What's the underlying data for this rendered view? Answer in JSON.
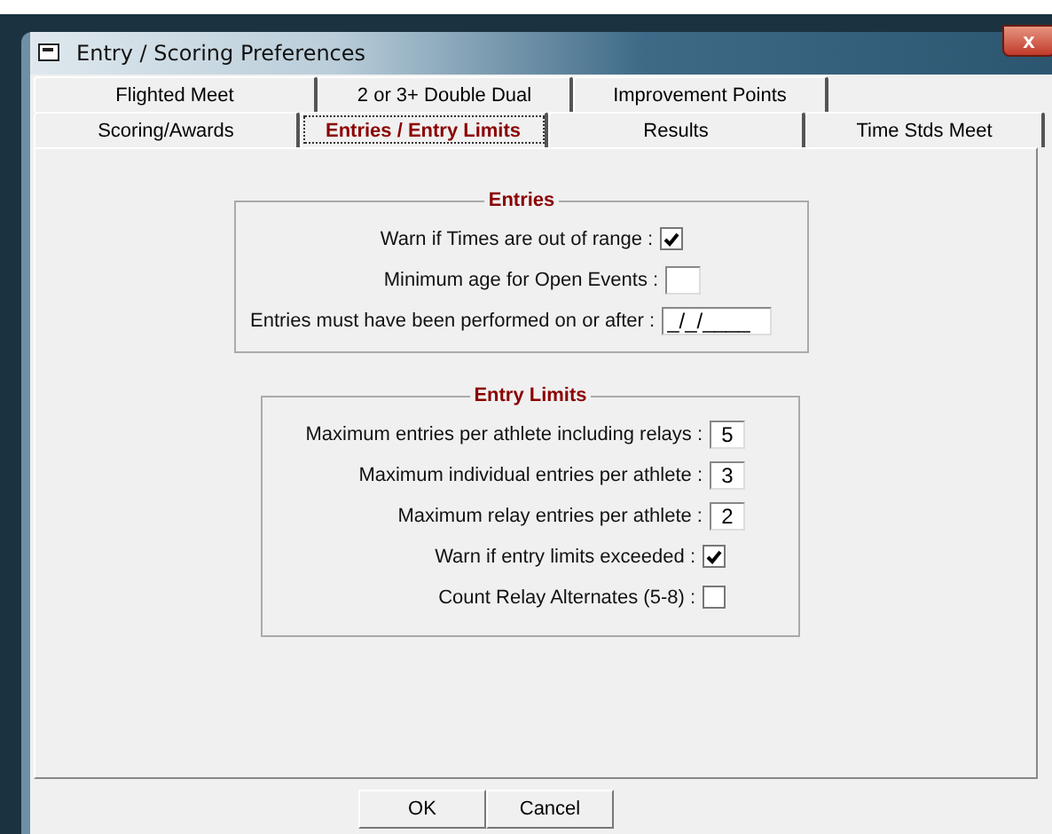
{
  "window": {
    "title": "Entry / Scoring Preferences",
    "close": "x"
  },
  "tab_rows": [
    [
      {
        "label": "Flighted Meet",
        "selected": false
      },
      {
        "label": "2 or 3+ Double Dual",
        "selected": false
      },
      {
        "label": "Improvement Points",
        "selected": false
      }
    ],
    [
      {
        "label": "Scoring/Awards",
        "selected": false
      },
      {
        "label": "Entries / Entry Limits",
        "selected": true
      },
      {
        "label": "Results",
        "selected": false
      },
      {
        "label": "Time Stds Meet",
        "selected": false
      }
    ]
  ],
  "groups": [
    {
      "title": "Entries",
      "rows": [
        {
          "kind": "checkbox",
          "label": "Warn if Times are out of range :",
          "checked": true
        },
        {
          "kind": "input",
          "label": "Minimum age for Open Events :"
        },
        {
          "kind": "date",
          "label": "Entries must have been performed on or after :",
          "value": "_/_/____"
        }
      ]
    },
    {
      "title": "Entry Limits",
      "rows": [
        {
          "kind": "input",
          "label": "Maximum entries per athlete including relays :",
          "value": "5"
        },
        {
          "kind": "input",
          "label": "Maximum individual entries per athlete :",
          "value": "3"
        },
        {
          "kind": "input",
          "label": "Maximum relay entries per athlete :",
          "value": "2"
        },
        {
          "kind": "checkbox",
          "label": "Warn if entry limits exceeded :",
          "checked": true
        },
        {
          "kind": "checkbox",
          "label": "Count Relay Alternates (5-8) :",
          "checked": false
        }
      ]
    }
  ],
  "buttons": [
    {
      "label": "OK"
    },
    {
      "label": "Cancel"
    }
  ]
}
